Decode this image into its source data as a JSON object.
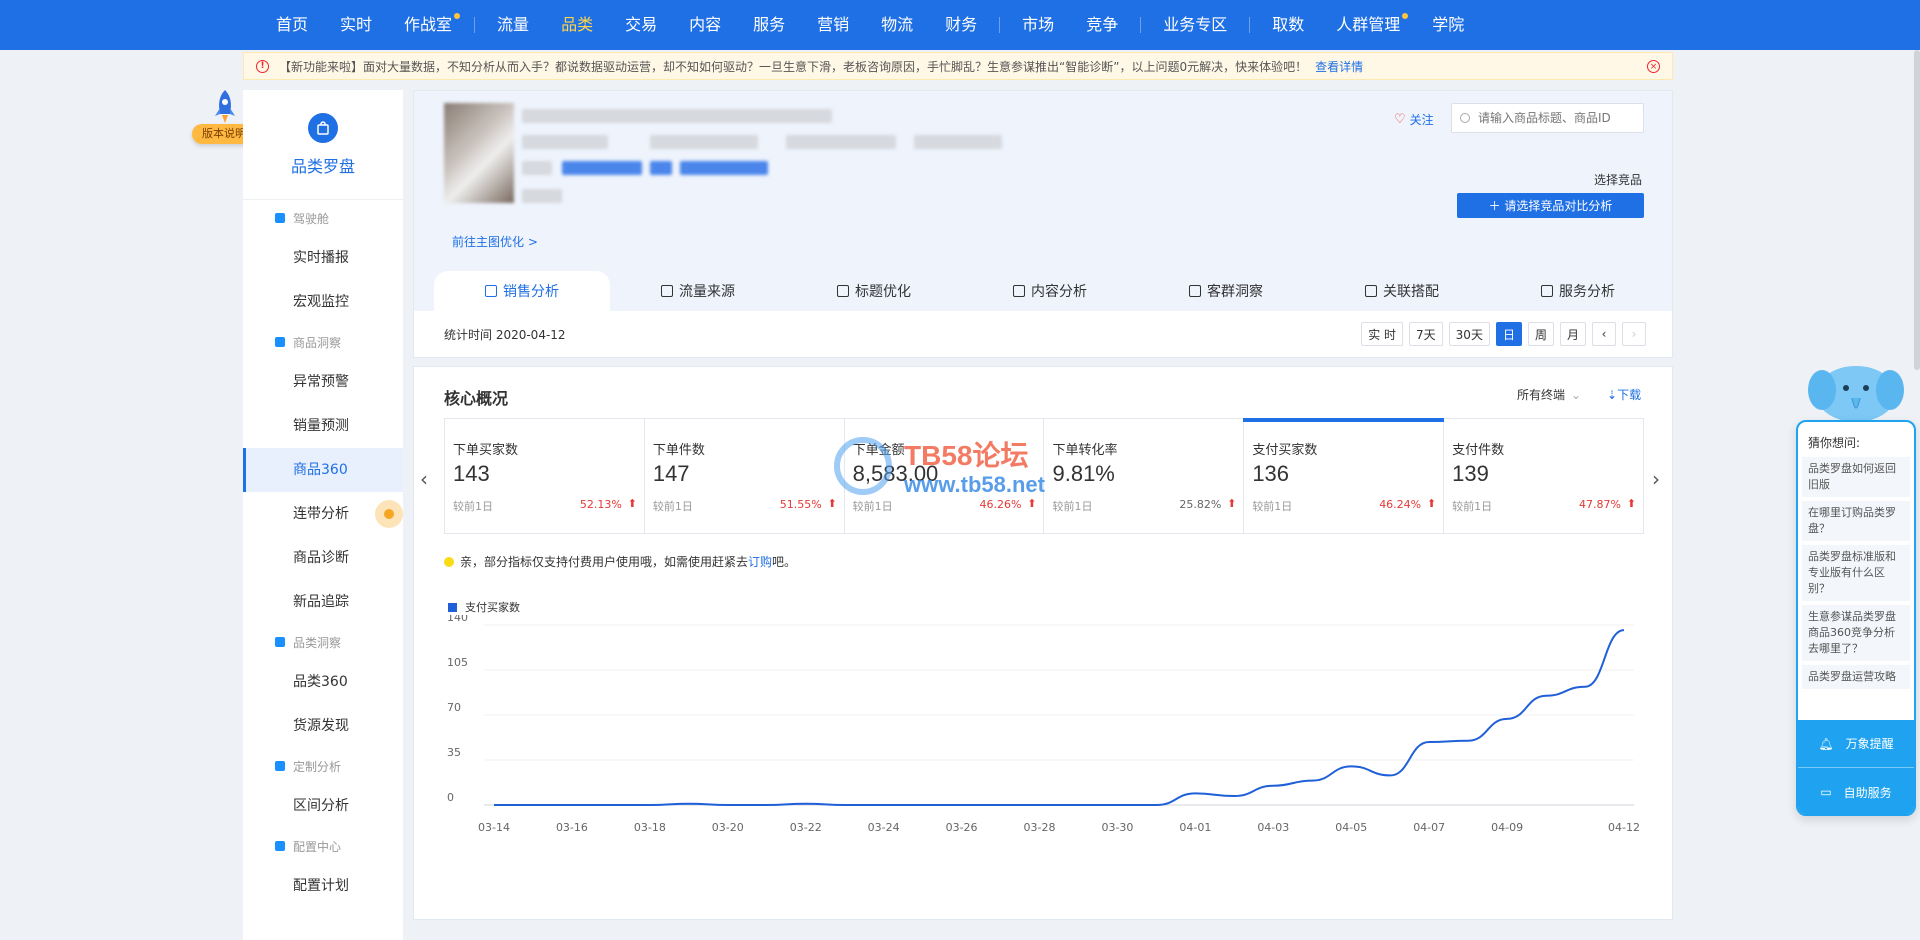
{
  "topnav": {
    "items": [
      {
        "label": "首页"
      },
      {
        "label": "实时"
      },
      {
        "label": "作战室",
        "dot": true
      },
      {
        "label": "流量"
      },
      {
        "label": "品类",
        "active": true
      },
      {
        "label": "交易"
      },
      {
        "label": "内容"
      },
      {
        "label": "服务"
      },
      {
        "label": "营销"
      },
      {
        "label": "物流"
      },
      {
        "label": "财务"
      },
      {
        "label": "市场"
      },
      {
        "label": "竞争"
      },
      {
        "label": "业务专区"
      },
      {
        "label": "取数"
      },
      {
        "label": "人群管理",
        "dot": true
      },
      {
        "label": "学院"
      }
    ]
  },
  "notice": {
    "text": "【新功能来啦】面对大量数据，不知分析从而入手？都说数据驱动运营，却不知如何驱动？一旦生意下滑，老板咨询原因，手忙脚乱？生意参谋推出“智能诊断”，以上问题0元解决，快来体验吧！",
    "link": "查看详情"
  },
  "rocket": {
    "badge": "版本说明"
  },
  "sidebar": {
    "brand": "品类罗盘",
    "sections": [
      {
        "group": "驾驶舱",
        "color": "#1890ff",
        "items": [
          "实时播报",
          "宏观监控"
        ]
      },
      {
        "group": "商品洞察",
        "color": "#1890ff",
        "items": [
          "异常预警",
          "销量预测",
          "商品360",
          "连带分析",
          "商品诊断",
          "新品追踪"
        ]
      },
      {
        "group": "品类洞察",
        "color": "#1890ff",
        "items": [
          "品类360",
          "货源发现"
        ]
      },
      {
        "group": "定制分析",
        "color": "#1890ff",
        "items": [
          "区间分析"
        ]
      },
      {
        "group": "配置中心",
        "color": "#1890ff",
        "items": [
          "配置计划"
        ]
      }
    ],
    "active_item": "商品360"
  },
  "product": {
    "goto_link": "前往主图优化 >",
    "follow": "关注",
    "search_placeholder": "请输入商品标题、商品ID",
    "choose_label": "选择竞品",
    "compare_button": "＋ 请选择竞品对比分析",
    "tabs": [
      "销售分析",
      "流量来源",
      "标题优化",
      "内容分析",
      "客群洞察",
      "关联搭配",
      "服务分析"
    ],
    "active_tab": "销售分析",
    "stat_time": "统计时间 2020-04-12",
    "date_buttons": [
      "实 时",
      "7天",
      "30天",
      "日",
      "周",
      "月",
      "‹",
      "›"
    ],
    "active_date": "日"
  },
  "core": {
    "title": "核心概况",
    "terminal": "所有终端",
    "download": "下载",
    "metrics": [
      {
        "label": "下单买家数",
        "value": "143",
        "cmp": "较前1日",
        "pct": "52.13%",
        "up": true
      },
      {
        "label": "下单件数",
        "value": "147",
        "cmp": "较前1日",
        "pct": "51.55%",
        "up": true
      },
      {
        "label": "下单金额",
        "value": "8,583.00",
        "cmp": "较前1日",
        "pct": "46.26%",
        "up": true
      },
      {
        "label": "下单转化率",
        "value": "9.81%",
        "cmp": "较前1日",
        "pct": "25.82%",
        "up": true,
        "gray": true
      },
      {
        "label": "支付买家数",
        "value": "136",
        "cmp": "较前1日",
        "pct": "46.24%",
        "up": true,
        "active": true
      },
      {
        "label": "支付件数",
        "value": "139",
        "cmp": "较前1日",
        "pct": "47.87%",
        "up": true
      }
    ],
    "tip_text": "亲，部分指标仅支持付费用户使用哦，如需使用赶紧去",
    "tip_link": "订购",
    "tip_tail": "吧。"
  },
  "chart_data": {
    "type": "line",
    "title": "",
    "xlabel": "",
    "ylabel": "",
    "ylim": [
      0,
      140
    ],
    "yticks": [
      0,
      35,
      70,
      105,
      140
    ],
    "x_tick_labels": [
      "03-14",
      "03-16",
      "03-18",
      "03-20",
      "03-22",
      "03-24",
      "03-26",
      "03-28",
      "03-30",
      "04-01",
      "04-03",
      "04-05",
      "04-07",
      "04-09",
      "04-12"
    ],
    "x": [
      "03-14",
      "03-15",
      "03-16",
      "03-17",
      "03-18",
      "03-19",
      "03-20",
      "03-21",
      "03-22",
      "03-23",
      "03-24",
      "03-25",
      "03-26",
      "03-27",
      "03-28",
      "03-29",
      "03-30",
      "03-31",
      "04-01",
      "04-02",
      "04-03",
      "04-04",
      "04-05",
      "04-06",
      "04-07",
      "04-08",
      "04-09",
      "04-10",
      "04-11",
      "04-12"
    ],
    "series": [
      {
        "name": "支付买家数",
        "color": "#1f5fd8",
        "values": [
          0,
          0,
          0,
          0,
          0,
          1,
          0,
          0,
          1,
          0,
          0,
          0,
          0,
          0,
          0,
          0,
          0,
          0,
          9,
          7,
          15,
          19,
          30,
          23,
          49,
          50,
          67,
          85,
          92,
          136
        ]
      }
    ],
    "legend_position": "top-left",
    "grid": true
  },
  "watermark": {
    "title": "TB58论坛",
    "url": "www.tb58.net"
  },
  "helper": {
    "guess": "猜你想问:",
    "questions": [
      "品类罗盘如何返回旧版",
      "在哪里订购品类罗盘？",
      "品类罗盘标准版和专业版有什么区别？",
      "生意参谋品类罗盘商品360竞争分析去哪里了？",
      "品类罗盘运营攻略"
    ],
    "button1": "万象提醒",
    "button2": "自助服务"
  }
}
